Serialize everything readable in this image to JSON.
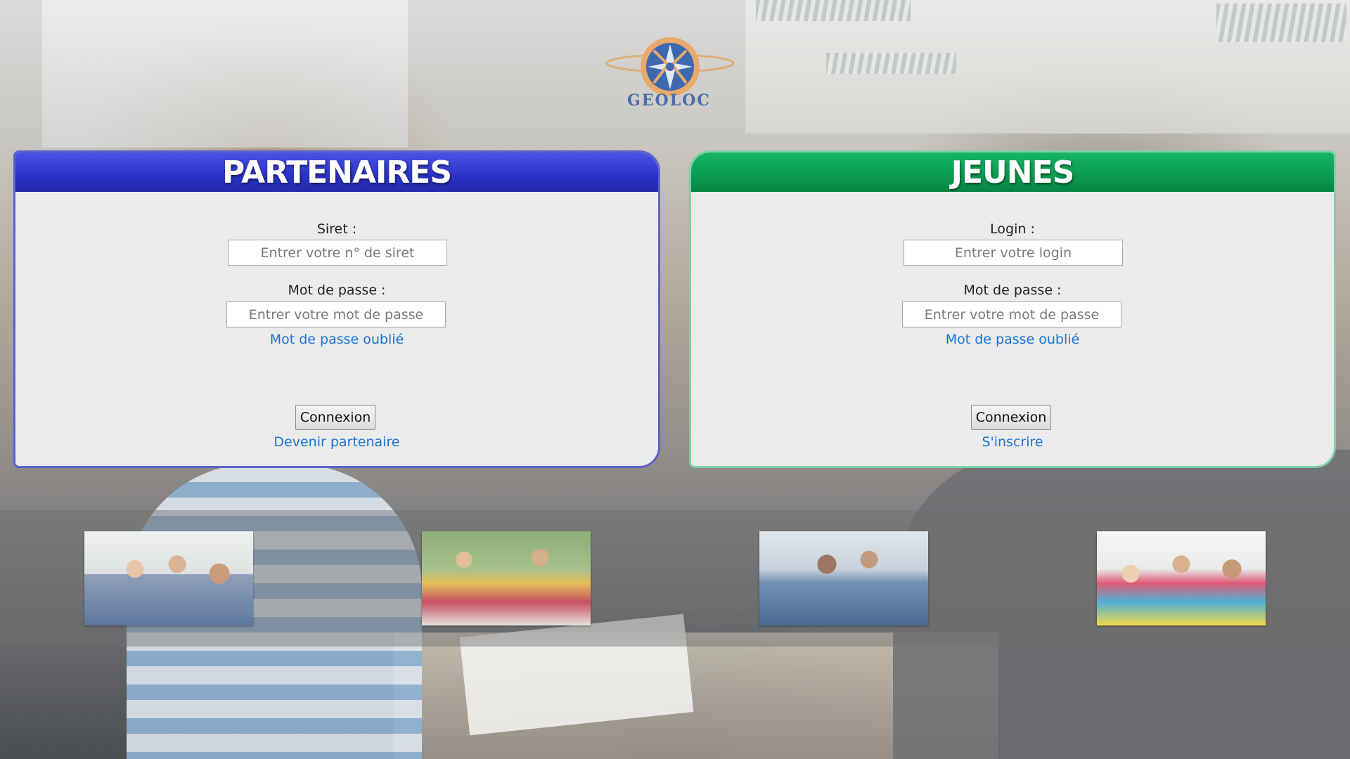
{
  "brand": {
    "logo_text": "GEOLOC"
  },
  "partners": {
    "title": "PARTENAIRES",
    "siret_label": "Siret :",
    "siret_placeholder": "Entrer votre n° de siret",
    "password_label": "Mot de passe :",
    "password_placeholder": "Entrer votre mot de passe",
    "forgot_link": "Mot de passe oublié",
    "submit_label": "Connexion",
    "register_link": "Devenir partenaire"
  },
  "youth": {
    "title": "JEUNES",
    "login_label": "Login :",
    "login_placeholder": "Entrer votre login",
    "password_label": "Mot de passe :",
    "password_placeholder": "Entrer votre mot de passe",
    "forgot_link": "Mot de passe oublié",
    "submit_label": "Connexion",
    "register_link": "S'inscrire"
  },
  "colors": {
    "partners_header": "#2a32c8",
    "youth_header": "#0a9b50",
    "link": "#1a73d8"
  },
  "gallery": [
    {
      "icon": "group-photo-classroom"
    },
    {
      "icon": "group-photo-graduates"
    },
    {
      "icon": "group-photo-computer-lab"
    },
    {
      "icon": "group-photo-thumbs-up"
    }
  ]
}
